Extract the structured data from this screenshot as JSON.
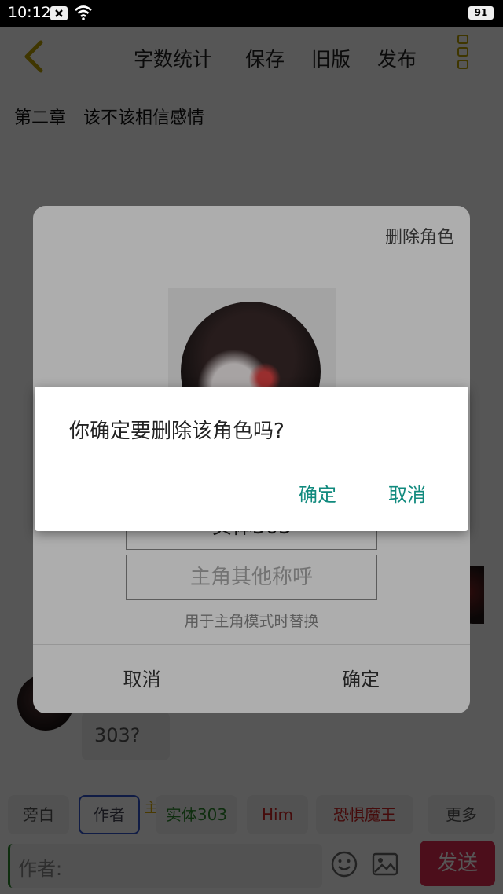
{
  "status_bar": {
    "time": "10:12",
    "battery": "91"
  },
  "header": {
    "actions": [
      "字数统计",
      "保存",
      "旧版",
      "发布"
    ]
  },
  "chapter_title": "第二章　该不该相信感情",
  "chat": {
    "bubble_text": "303?"
  },
  "role_chips": {
    "narration": "旁白",
    "author": "作者",
    "main_badge": "主",
    "entity": "实体303",
    "him": "Him",
    "demon": "恐惧魔王",
    "more": "更多"
  },
  "input": {
    "placeholder": "作者:",
    "send_label": "发送"
  },
  "role_dialog": {
    "delete_label": "删除角色",
    "name_value": "实体303",
    "alias_placeholder": "主角其他称呼",
    "alias_hint": "用于主角模式时替换",
    "cancel_label": "取消",
    "confirm_label": "确定"
  },
  "alert_dialog": {
    "message": "你确定要删除该角色吗?",
    "confirm_label": "确定",
    "cancel_label": "取消",
    "accent_color": "#118a7e"
  },
  "colors": {
    "header_accent": "#bba000",
    "send_button": "#e02a52",
    "author_chip_border": "#3355cc"
  },
  "icons": [
    "back-arrow-icon",
    "more-icon",
    "wifi-icon",
    "notification-icon",
    "emoji-icon",
    "image-icon"
  ]
}
